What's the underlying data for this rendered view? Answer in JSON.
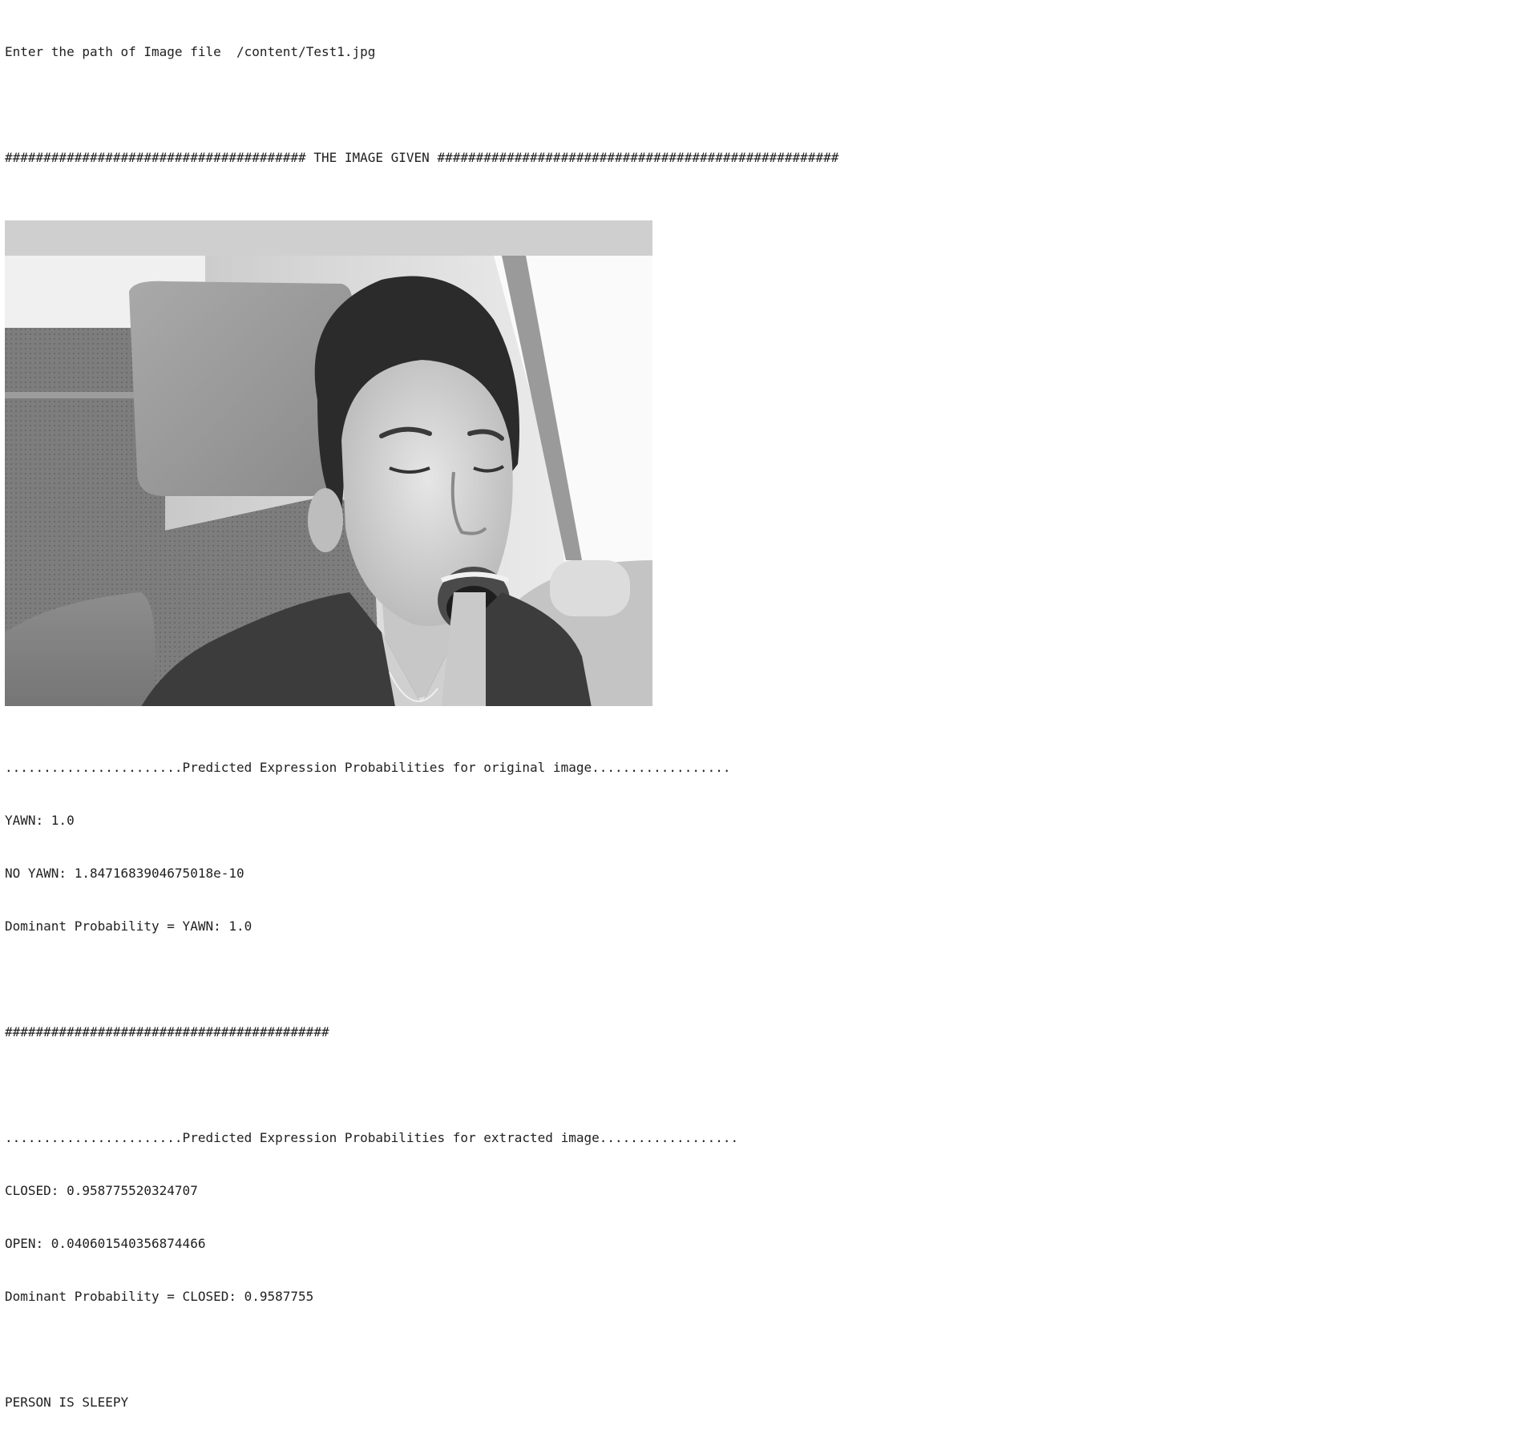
{
  "output": {
    "prompt_label": "Enter the path of Image file ",
    "prompt_value": "/content/Test1.jpg",
    "image_header": "####################################### THE IMAGE GIVEN ####################################################",
    "image": {
      "description_icon": "grayscale-photo"
    },
    "original": {
      "heading": ".......................Predicted Expression Probabilities for original image..................",
      "lines": [
        "YAWN: 1.0",
        "NO YAWN: 1.8471683904675018e-10",
        "Dominant Probability = YAWN: 1.0"
      ]
    },
    "separator": "##########################################",
    "extracted": {
      "heading": ".......................Predicted Expression Probabilities for extracted image..................",
      "lines": [
        "CLOSED: 0.958775520324707",
        "OPEN: 0.040601540356874466",
        "Dominant Probability = CLOSED: 0.9587755"
      ]
    },
    "verdict": "PERSON IS SLEEPY"
  }
}
